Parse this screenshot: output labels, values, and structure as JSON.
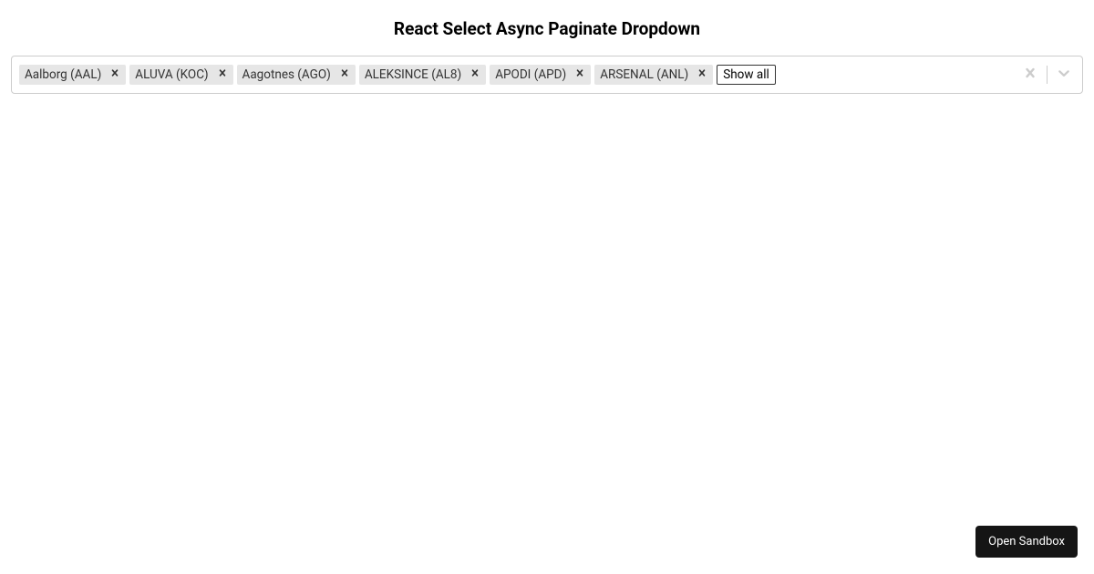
{
  "header": {
    "title": "React Select Async Paginate Dropdown"
  },
  "select": {
    "selected": [
      {
        "label": "Aalborg (AAL)"
      },
      {
        "label": "ALUVA (KOC)"
      },
      {
        "label": "Aagotnes (AGO)"
      },
      {
        "label": "ALEKSINCE (AL8)"
      },
      {
        "label": "APODI (APD)"
      },
      {
        "label": "ARSENAL (ANL)"
      }
    ],
    "show_all_label": "Show all"
  },
  "footer": {
    "open_sandbox_label": "Open Sandbox"
  }
}
